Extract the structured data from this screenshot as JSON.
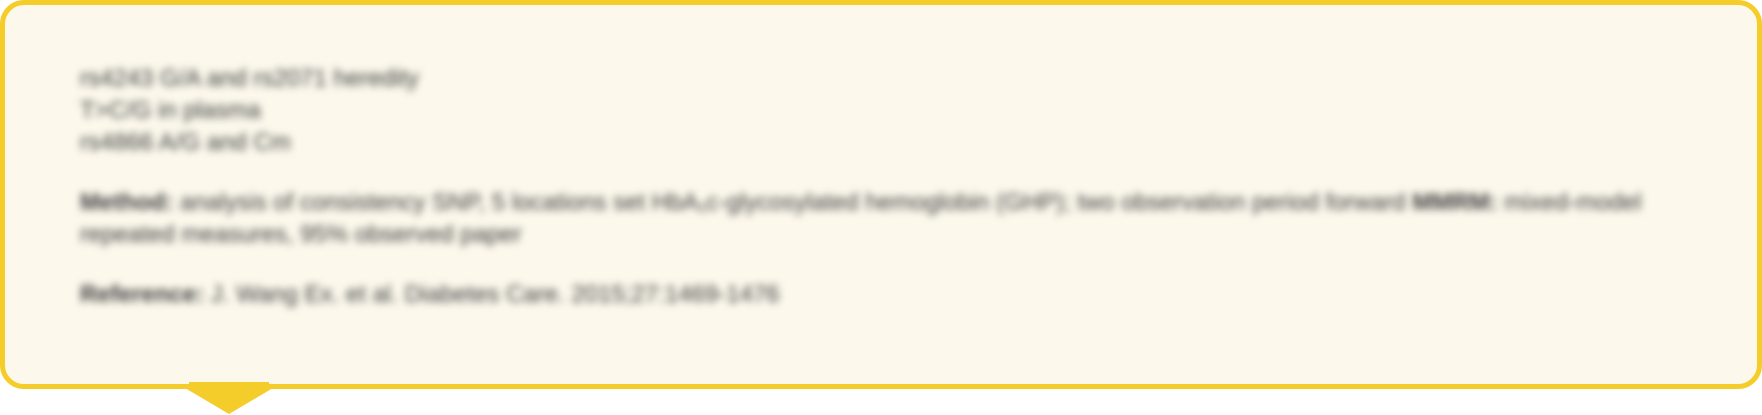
{
  "tooltip": {
    "lines": [
      "rs4243 G/A and rs2071 heredity",
      "T>C/G in plasma",
      "rs4866 A/G and Cm"
    ],
    "body": {
      "label": "Method:",
      "text": "analysis of consistency SNP, 5 locations set HbA₁c-glycosylated hemoglobin (GHP); two observation period forward",
      "label2": "MMRM:",
      "text2": "mixed-model repeated measures, 95% observed paper"
    },
    "reference": {
      "label": "Reference:",
      "text": "J. Wang Ex. et al. Diabetes Care. 2015;27:1469-1476"
    },
    "colors": {
      "border": "#f5cd2b",
      "background": "#fcf8ec",
      "text": "#3b3b3b"
    }
  }
}
